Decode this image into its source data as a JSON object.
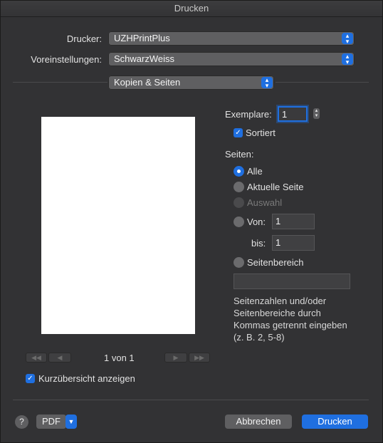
{
  "window": {
    "title": "Drucken"
  },
  "printer": {
    "label": "Drucker:",
    "value": "UZHPrintPlus"
  },
  "presets": {
    "label": "Voreinstellungen:",
    "value": "SchwarzWeiss"
  },
  "section": {
    "value": "Kopien & Seiten"
  },
  "copies": {
    "label": "Exemplare:",
    "value": "1"
  },
  "collate": {
    "label": "Sortiert",
    "checked": true
  },
  "pages": {
    "label": "Seiten:",
    "all": "Alle",
    "current": "Aktuelle Seite",
    "selection": "Auswahl",
    "from_label": "Von:",
    "from_value": "1",
    "to_label": "bis:",
    "to_value": "1",
    "range_label": "Seitenbereich",
    "range_value": "",
    "hint": "Seitenzahlen und/oder Seitenbereiche durch Kommas getrennt eingeben (z. B. 2, 5-8)"
  },
  "preview": {
    "page_indicator": "1 von 1",
    "show_details_label": "Kurzübersicht anzeigen"
  },
  "footer": {
    "help": "?",
    "pdf_label": "PDF",
    "cancel_label": "Abbrechen",
    "print_label": "Drucken"
  },
  "colors": {
    "accent": "#1f6fe0",
    "window_bg": "#323234"
  }
}
